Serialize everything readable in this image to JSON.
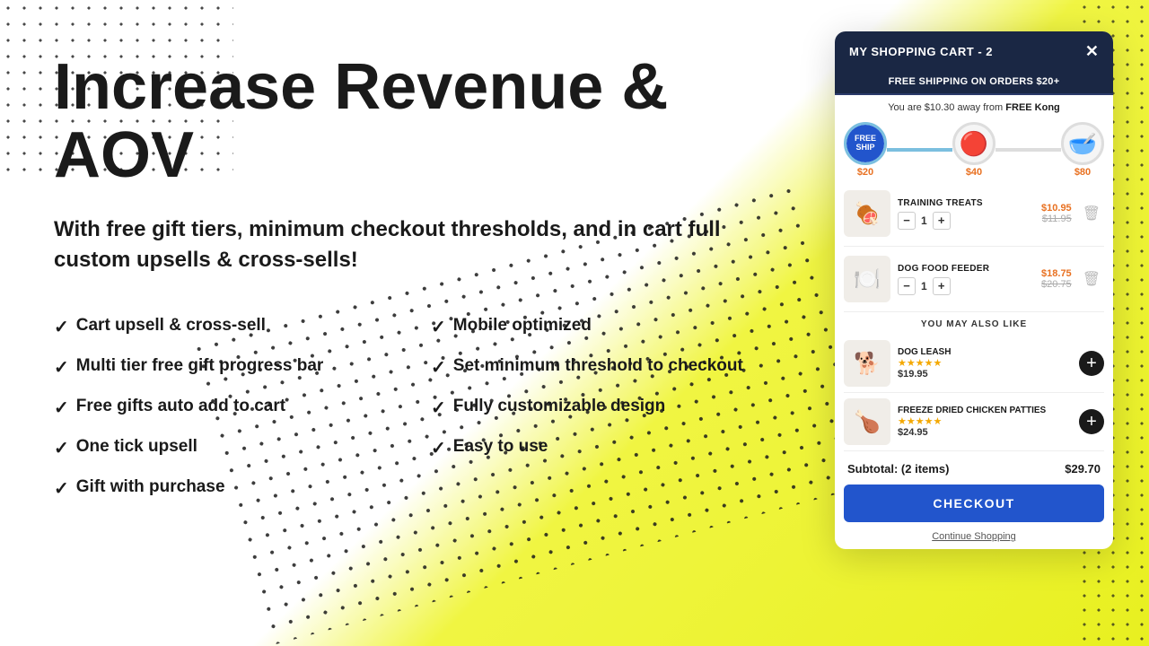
{
  "background": {
    "color": "#f5f542"
  },
  "left": {
    "title": "Increase Revenue & AOV",
    "subtitle": "With free gift tiers, minimum checkout thresholds, and in cart full custom upsells & cross-sells!",
    "features": [
      {
        "col": 0,
        "text": "Cart upsell & cross-sell"
      },
      {
        "col": 1,
        "text": "Mobile optimized"
      },
      {
        "col": 0,
        "text": "Multi tier free gift progress bar"
      },
      {
        "col": 1,
        "text": "Set minimum threshold to checkout"
      },
      {
        "col": 0,
        "text": "Free gifts auto add to cart"
      },
      {
        "col": 1,
        "text": "Fully customizable design"
      },
      {
        "col": 0,
        "text": "One tick upsell"
      },
      {
        "col": 1,
        "text": "Easy to use"
      },
      {
        "col": 0,
        "text": "Gift with purchase"
      }
    ]
  },
  "cart": {
    "title": "MY SHOPPING CART - 2",
    "close_label": "✕",
    "free_shipping_banner": "FREE SHIPPING ON ORDERS $20+",
    "free_kong_msg": "You are $10.30 away from",
    "free_kong_highlight": "FREE Kong",
    "tiers": [
      {
        "label": "$20",
        "icon": "🚚",
        "type": "badge",
        "active": true,
        "completed": true
      },
      {
        "label": "$40",
        "icon": "🔴",
        "type": "img",
        "active": false
      },
      {
        "label": "$80",
        "icon": "🥣",
        "type": "img",
        "active": false
      }
    ],
    "items": [
      {
        "name": "TRAINING TREATS",
        "qty": 1,
        "price_current": "$10.95",
        "price_original": "$11.95",
        "emoji": "🍖"
      },
      {
        "name": "DOG FOOD FEEDER",
        "qty": 1,
        "price_current": "$18.75",
        "price_original": "$20.75",
        "emoji": "🍽️"
      }
    ],
    "you_may_like_label": "YOU MAY ALSO LIKE",
    "upsell_items": [
      {
        "name": "DOG LEASH",
        "stars": "★★★★★",
        "price": "$19.95",
        "emoji": "🐕"
      },
      {
        "name": "FREEZE DRIED CHICKEN PATTIES",
        "stars": "★★★★★",
        "price": "$24.95",
        "emoji": "🍗"
      }
    ],
    "subtotal_label": "Subtotal: (2 items)",
    "subtotal_value": "$29.70",
    "checkout_label": "CHECKOUT",
    "continue_label": "Continue Shopping"
  }
}
